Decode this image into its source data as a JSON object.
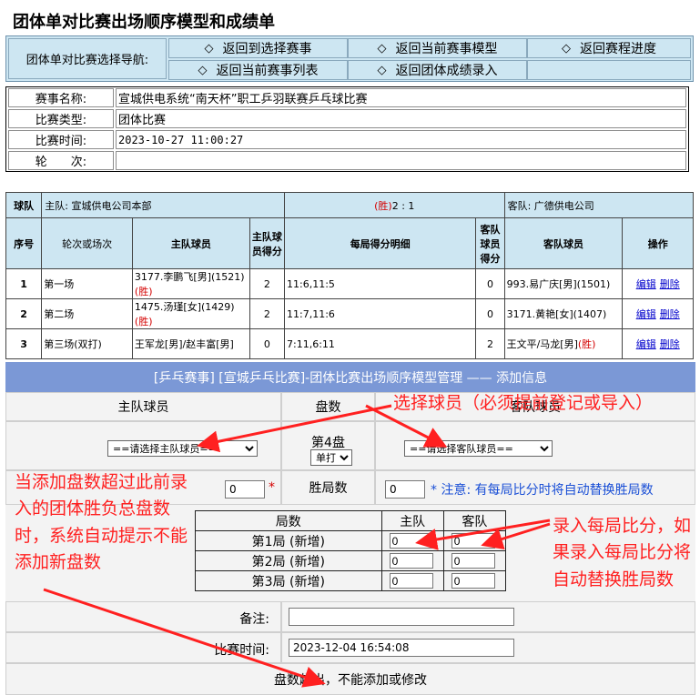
{
  "page_title": "团体单对比赛出场顺序模型和成绩单",
  "nav": {
    "label": "团体单对比赛选择导航:",
    "links": [
      "返回到选择赛事",
      "返回当前赛事模型",
      "返回赛程进度",
      "返回当前赛事列表",
      "返回团体成绩录入"
    ],
    "diamond": "◇"
  },
  "info": [
    {
      "label": "赛事名称:",
      "value": "宣城供电系统“南天杯”职工乒羽联赛乒乓球比赛"
    },
    {
      "label": "比赛类型:",
      "value": "团体比赛"
    },
    {
      "label": "比赛时间:",
      "value": "2023-10-27 11:00:27"
    },
    {
      "label": "轮　　次:",
      "value": ""
    }
  ],
  "result": {
    "team_label": "球队",
    "home_team": "主队:  宣城供电公司本部",
    "score_win": "(胜)",
    "score": "2 :  1",
    "away_team": "客队:  广德供电公司",
    "headers": [
      "序号",
      "轮次或场次",
      "主队球员",
      "主队球员得分",
      "每局得分明细",
      "客队球员得分",
      "客队球员",
      "操作"
    ],
    "rows": [
      {
        "no": "1",
        "round": "第一场",
        "home": "3177.李鹏飞[男](1521)",
        "home_win": "(胜)",
        "hs": "2",
        "detail": "11:6,11:5",
        "as": "0",
        "away": "993.易广庆[男](1501)",
        "away_win": ""
      },
      {
        "no": "2",
        "round": "第二场",
        "home": "1475.汤瑾[女](1429)",
        "home_win": "(胜)",
        "hs": "2",
        "detail": "11:7,11:6",
        "as": "0",
        "away": "3171.黄艳[女](1407)",
        "away_win": ""
      },
      {
        "no": "3",
        "round": "第三场(双打)",
        "home": "王军龙[男]/赵丰富[男]",
        "home_win": "",
        "hs": "0",
        "detail": "7:11,6:11",
        "as": "2",
        "away": "王文平/马龙[男]",
        "away_win": "(胜)"
      }
    ],
    "edit": "编辑",
    "delete": "删除"
  },
  "form": {
    "banner": "[乒乓赛事] [宣城乒乓比赛]-团体比赛出场顺序模型管理 —— 添加信息",
    "home_player_label": "主队球员",
    "set_label": "盘数",
    "away_player_label": "客队球员",
    "home_select": "==请选择主队球员==",
    "away_select": "==请选择客队球员==",
    "set_num": "第4盘",
    "set_type": "单打",
    "home_wins": "0",
    "required": "*",
    "wins_label": "胜局数",
    "away_wins": "0",
    "note": "* 注意: 有每局比分时将自动替换胜局数",
    "score_headers": [
      "局数",
      "主队",
      "客队"
    ],
    "games": [
      {
        "label": "第1局 (新增)",
        "home": "0",
        "away": "0"
      },
      {
        "label": "第2局 (新增)",
        "home": "0",
        "away": "0"
      },
      {
        "label": "第3局 (新增)",
        "home": "0",
        "away": "0"
      }
    ],
    "remark_label": "备注:",
    "remark_value": "",
    "time_label": "比赛时间:",
    "time_value": "2023-12-04 16:54:08",
    "bottom_msg": "盘数超出，不能添加或修改"
  },
  "annotations": {
    "select_player": "选择球员（必须提前登记或导入）",
    "left": "当添加盘数超过此前录入的团体胜负总盘数时，系统自动提示不能添加新盘数",
    "right": "录入每局比分，如果录入每局比分将自动替换胜局数"
  },
  "colors": {
    "nav_bg": "#cde6f2",
    "banner_bg": "#7b98d6",
    "annotation": "#ff2020",
    "win": "#d40000"
  }
}
